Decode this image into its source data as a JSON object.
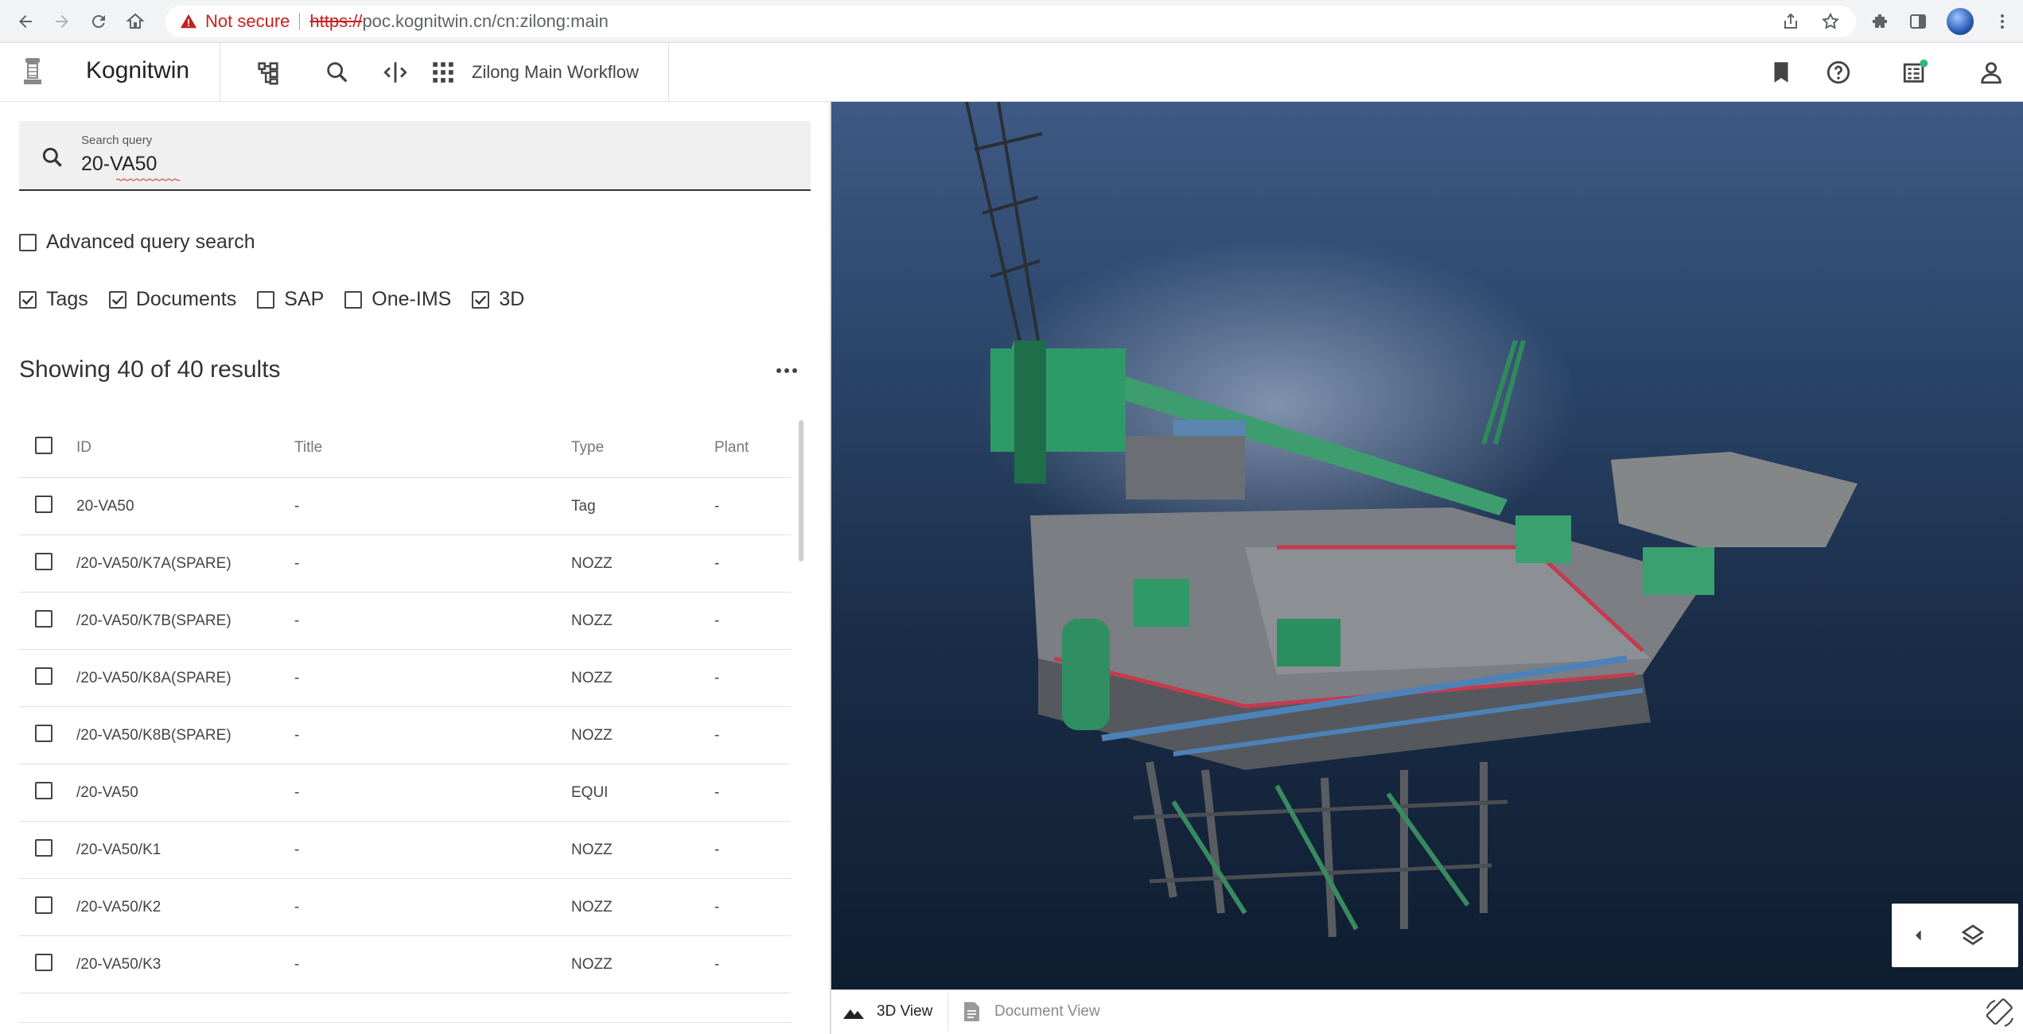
{
  "browser": {
    "security_label": "Not secure",
    "url_scheme": "https://",
    "url_rest": "poc.kognitwin.cn/cn:zilong:main"
  },
  "app": {
    "brand": "Kognitwin",
    "workflow": "Zilong Main Workflow"
  },
  "search": {
    "label": "Search query",
    "value": "20-VA50"
  },
  "advanced": {
    "label": "Advanced query search",
    "checked": false
  },
  "filters": [
    {
      "label": "Tags",
      "checked": true
    },
    {
      "label": "Documents",
      "checked": true
    },
    {
      "label": "SAP",
      "checked": false
    },
    {
      "label": "One-IMS",
      "checked": false
    },
    {
      "label": "3D",
      "checked": true
    }
  ],
  "results": {
    "summary": "Showing 40 of 40 results",
    "columns": [
      "ID",
      "Title",
      "Type",
      "Plant"
    ],
    "rows": [
      {
        "id": "20-VA50",
        "title": "-",
        "type": "Tag",
        "plant": "-"
      },
      {
        "id": "/20-VA50/K7A(SPARE)",
        "title": "-",
        "type": "NOZZ",
        "plant": "-"
      },
      {
        "id": "/20-VA50/K7B(SPARE)",
        "title": "-",
        "type": "NOZZ",
        "plant": "-"
      },
      {
        "id": "/20-VA50/K8A(SPARE)",
        "title": "-",
        "type": "NOZZ",
        "plant": "-"
      },
      {
        "id": "/20-VA50/K8B(SPARE)",
        "title": "-",
        "type": "NOZZ",
        "plant": "-"
      },
      {
        "id": "/20-VA50",
        "title": "-",
        "type": "EQUI",
        "plant": "-"
      },
      {
        "id": "/20-VA50/K1",
        "title": "-",
        "type": "NOZZ",
        "plant": "-"
      },
      {
        "id": "/20-VA50/K2",
        "title": "-",
        "type": "NOZZ",
        "plant": "-"
      },
      {
        "id": "/20-VA50/K3",
        "title": "-",
        "type": "NOZZ",
        "plant": "-"
      }
    ]
  },
  "viewer": {
    "tabs": [
      {
        "label": "3D View",
        "active": true,
        "icon": "mountain-icon"
      },
      {
        "label": "Document View",
        "active": false,
        "icon": "document-icon"
      }
    ]
  }
}
